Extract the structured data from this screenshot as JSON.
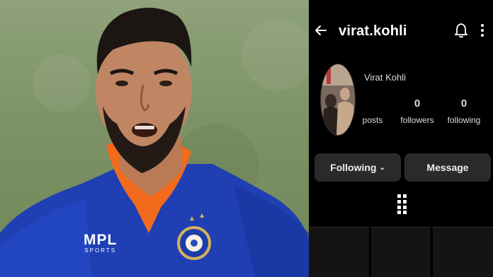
{
  "photo": {
    "logo_text": "MPL",
    "logo_sub": "SPORTS"
  },
  "profile": {
    "username": "virat.kohli",
    "display_name": "Virat Kohli",
    "posts_count": "",
    "posts_label": "posts",
    "followers_count": "0",
    "followers_label": "followers",
    "following_count": "0",
    "following_label": "following"
  },
  "actions": {
    "following_label": "Following",
    "message_label": "Message"
  },
  "icons": {
    "back": "arrow-left-icon",
    "bell": "bell-icon",
    "more": "more-vertical-icon",
    "grid": "grid-icon",
    "chevron": "chevron-down-icon"
  },
  "colors": {
    "jersey_blue": "#1f3fb3",
    "collar_orange": "#f26a1b",
    "app_background": "#000000",
    "button_background": "#2a2a2a"
  }
}
